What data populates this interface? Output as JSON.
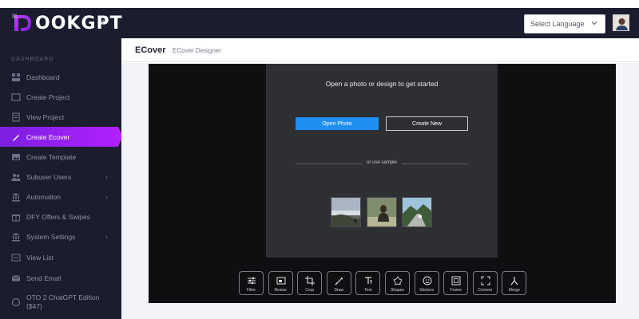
{
  "app": {
    "logo_text": "OOKGPT"
  },
  "header": {
    "language_select": "Select Language"
  },
  "sidebar": {
    "section_label": "DASHBOARD",
    "items": [
      {
        "label": "Dashboard",
        "icon": "dashboard-icon"
      },
      {
        "label": "Create Project",
        "icon": "folder-icon"
      },
      {
        "label": "View Project",
        "icon": "document-icon"
      },
      {
        "label": "Create Ecover",
        "icon": "pencil-icon",
        "active": true
      },
      {
        "label": "Create Template",
        "icon": "image-icon"
      },
      {
        "label": "Subuser Users",
        "icon": "users-icon",
        "has_arrow": true
      },
      {
        "label": "Automation",
        "icon": "bank-icon",
        "has_arrow": true
      },
      {
        "label": "DFY Offers & Swipes",
        "icon": "gift-icon"
      },
      {
        "label": "System Settings",
        "icon": "bank-icon",
        "has_arrow": true
      },
      {
        "label": "View List",
        "icon": "list-icon"
      },
      {
        "label": "Send Email",
        "icon": "mail-icon"
      },
      {
        "label": "OTO 2 ChatGPT Edition ($47)",
        "icon": "circle-icon"
      }
    ]
  },
  "page": {
    "title": "ECover",
    "subtitle": "ECover Designer"
  },
  "editor": {
    "prompt": "Open a photo or design to get started",
    "open_photo": "Open Photo",
    "create_new": "Create New",
    "or_sample": "or use sample",
    "tools": [
      {
        "label": "Filter",
        "icon": "sliders-icon"
      },
      {
        "label": "Resize",
        "icon": "resize-icon"
      },
      {
        "label": "Crop",
        "icon": "crop-icon"
      },
      {
        "label": "Draw",
        "icon": "brush-icon"
      },
      {
        "label": "Text",
        "icon": "text-icon"
      },
      {
        "label": "Shapes",
        "icon": "shapes-icon"
      },
      {
        "label": "Stickers",
        "icon": "sticker-icon"
      },
      {
        "label": "Frame",
        "icon": "frame-icon"
      },
      {
        "label": "Corners",
        "icon": "corners-icon"
      },
      {
        "label": "Merge",
        "icon": "merge-icon"
      }
    ]
  },
  "colors": {
    "sidebar_bg": "#1b1d2e",
    "active_start": "#7b1fe0",
    "active_end": "#b020ff",
    "primary_button": "#1f8ef1",
    "editor_bg": "#0e0f11",
    "panel_bg": "#2e2f32"
  }
}
